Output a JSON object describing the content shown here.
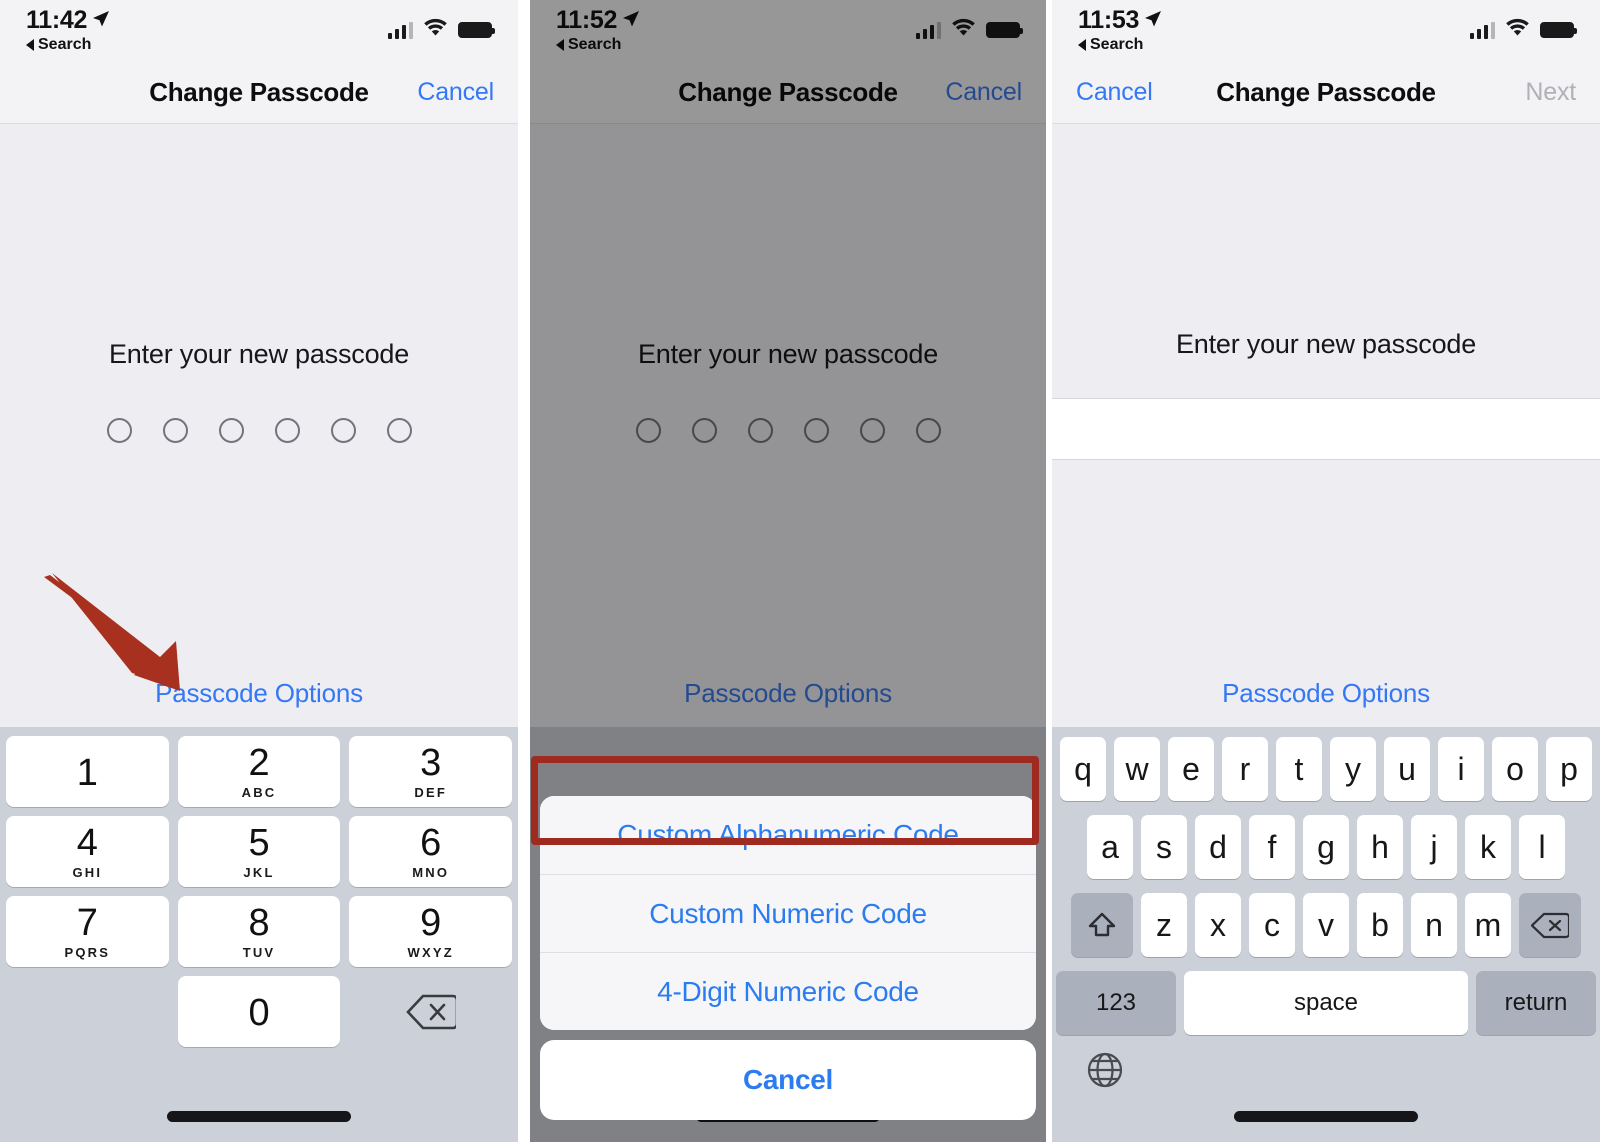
{
  "accent_blue": "#3478f6",
  "annotation_red": "#9e2a20",
  "panels": [
    {
      "id": "panel-1",
      "statusbar": {
        "time": "11:42",
        "back_label": "Search",
        "location_icon": "location-arrow-icon",
        "signal_icon": "cellular-signal-icon",
        "wifi_icon": "wifi-icon",
        "battery_icon": "battery-icon"
      },
      "navbar": {
        "title": "Change Passcode",
        "right_button": "Cancel"
      },
      "prompt": "Enter your new passcode",
      "dot_count": 6,
      "passcode_options": "Passcode Options",
      "annotation": {
        "type": "arrow",
        "target": "Passcode Options"
      },
      "keypad": [
        {
          "num": "1",
          "sub": ""
        },
        {
          "num": "2",
          "sub": "ABC"
        },
        {
          "num": "3",
          "sub": "DEF"
        },
        {
          "num": "4",
          "sub": "GHI"
        },
        {
          "num": "5",
          "sub": "JKL"
        },
        {
          "num": "6",
          "sub": "MNO"
        },
        {
          "num": "7",
          "sub": "PQRS"
        },
        {
          "num": "8",
          "sub": "TUV"
        },
        {
          "num": "9",
          "sub": "WXYZ"
        },
        {
          "num": "0",
          "sub": ""
        }
      ],
      "delete_icon": "delete-backward-icon"
    },
    {
      "id": "panel-2",
      "statusbar": {
        "time": "11:52",
        "back_label": "Search",
        "location_icon": "location-arrow-icon",
        "signal_icon": "cellular-signal-icon",
        "wifi_icon": "wifi-icon",
        "battery_icon": "battery-icon"
      },
      "navbar": {
        "title": "Change Passcode",
        "right_button": "Cancel"
      },
      "prompt": "Enter your new passcode",
      "dot_count": 6,
      "passcode_options": "Passcode Options",
      "action_sheet": {
        "options": [
          "Custom Alphanumeric Code",
          "Custom Numeric Code",
          "4-Digit Numeric Code"
        ],
        "cancel": "Cancel",
        "highlighted_option": "Custom Alphanumeric Code"
      }
    },
    {
      "id": "panel-3",
      "statusbar": {
        "time": "11:53",
        "back_label": "Search",
        "location_icon": "location-arrow-icon",
        "signal_icon": "cellular-signal-icon",
        "wifi_icon": "wifi-icon",
        "battery_icon": "battery-icon"
      },
      "navbar": {
        "left_button": "Cancel",
        "title": "Change Passcode",
        "right_button": "Next"
      },
      "prompt": "Enter your new passcode",
      "text_field_value": "",
      "passcode_options": "Passcode Options",
      "keyboard": {
        "row1": [
          "q",
          "w",
          "e",
          "r",
          "t",
          "y",
          "u",
          "i",
          "o",
          "p"
        ],
        "row2": [
          "a",
          "s",
          "d",
          "f",
          "g",
          "h",
          "j",
          "k",
          "l"
        ],
        "row3": [
          "z",
          "x",
          "c",
          "v",
          "b",
          "n",
          "m"
        ],
        "shift_icon": "shift-arrow-icon",
        "delete_icon": "delete-backward-icon",
        "numbers_key": "123",
        "space_key": "space",
        "return_key": "return",
        "globe_icon": "globe-icon"
      }
    }
  ]
}
